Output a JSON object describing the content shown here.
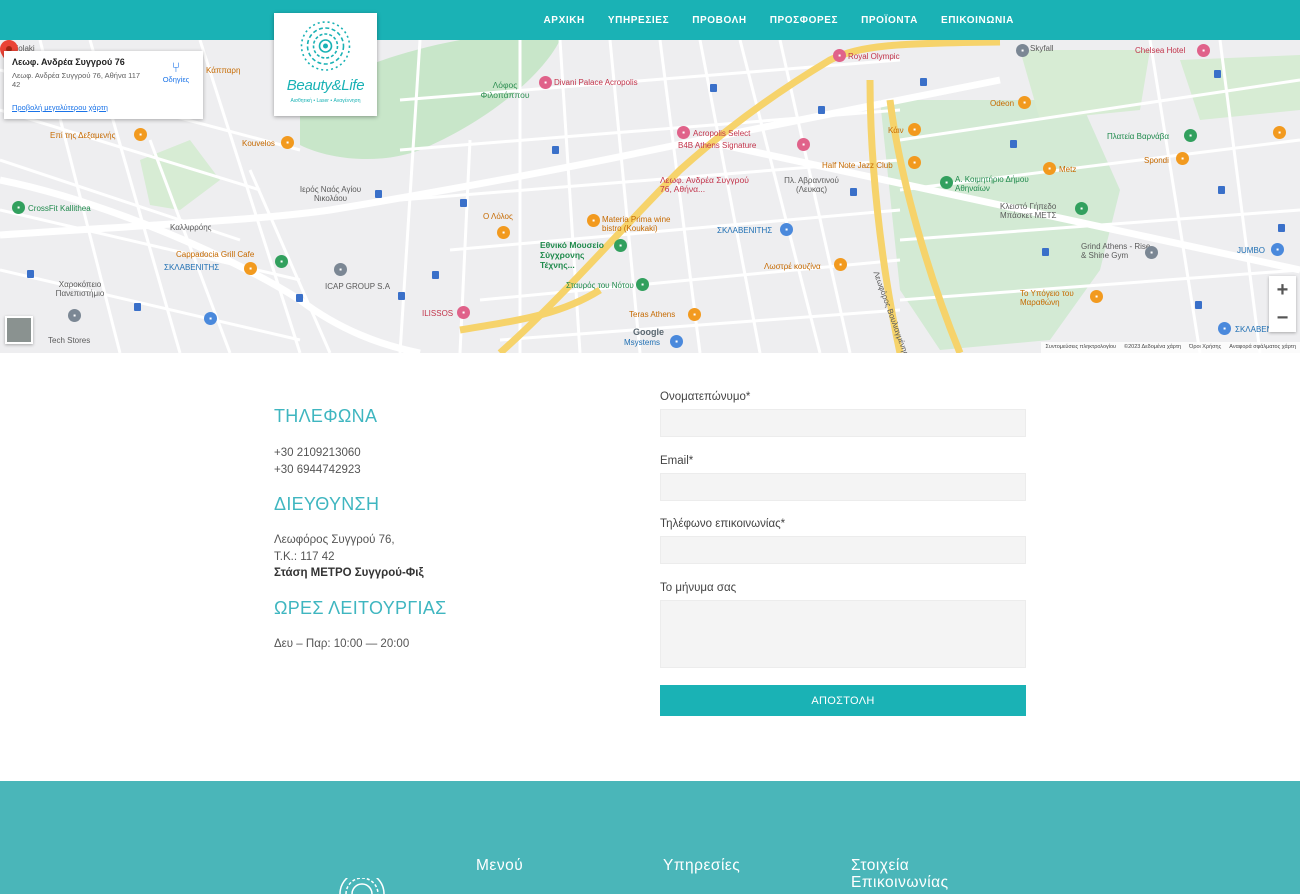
{
  "nav": {
    "items": [
      "ΑΡΧΙΚΗ",
      "ΥΠΗΡΕΣΙΕΣ",
      "ΠΡΟΒΟΛΗ",
      "ΠΡΟΣΦΟΡΕΣ",
      "ΠΡΟΪΟΝΤΑ",
      "ΕΠΙΚΟΙΝΩΝΙΑ"
    ]
  },
  "logo": {
    "name": "Beauty&Life",
    "tagline": "Αισθητική • Laser • Αναγέννηση"
  },
  "map": {
    "card_title": "Λεωφ. Ανδρέα Συγγρού 76",
    "card_address": "Λεωφ. Ανδρέα Συγγρού 76, Αθήνα 117 42",
    "card_link": "Προβολή μεγαλύτερου χάρτη",
    "directions": "Οδηγίες",
    "pin_label": "Λεωφ. Ανδρέα Συγγρού 76, Αθήνα...",
    "google": "Google",
    "zoom_in": "+",
    "zoom_out": "−",
    "attribution": [
      "Συντομεύσεις πληκτρολογίου",
      "©2023 Δεδομένα χάρτη",
      "Όροι Χρήσης",
      "Αναφορά σφάλματος χάρτη"
    ],
    "labels": {
      "acropolis_hotel": "Divani Palace Acropolis",
      "filopappou": "Λόφος Φιλοπάππου",
      "royal_olympic": "Royal Olympic",
      "chelsea": "Chelsea Hotel",
      "skyfall": "Skyfall",
      "acropolis_select": "Acropolis Select",
      "b4b": "B4B Athens Signature",
      "half_note": "Half Note Jazz Club",
      "kain": "Κάιν",
      "odeon": "Odeon",
      "varnava": "Πλατεία Βαρνάβα",
      "spondi": "Spondi",
      "metz": "Metz",
      "koimitirio": "Α. Κοιμητήριο Δήμου Αθηναίων",
      "klisto": "Κλειστό Γήπεδο Μπάσκετ ΜΕΤΣ",
      "grind": "Grind Athens - Rise & Shine Gym",
      "jumbo": "JUMBO",
      "ypogeio": "Το Υπόγειο του Μαραθώνη",
      "sklavenitis_r": "ΣΚΛΑΒΕΝΙΤΗΣ",
      "sklavenitis_m": "ΣΚΛΑΒΕΝΙΤΗΣ",
      "sklavenitis_l": "ΣΚΛΑΒΕΝΙΤΗΣ",
      "lostre": "Λωστρέ κουζίνα",
      "teras": "Teras Athens",
      "msystems": "Msystems",
      "stavros": "Σταυρός του Νότου",
      "emst": "Εθνικό Μουσείο Σύγχρονης Τέχνης...",
      "materia": "Materia Prima wine bistro (Koukaki)",
      "lolos": "Ο Λόλος",
      "ilissos": "ILISSOS",
      "icap": "ICAP GROUP S.A",
      "cappadocia": "Cappadocia Grill Cafe",
      "crossfit": "CrossFit Kallithea",
      "xarokopeio": "Χαροκόπειο Πανεπιστήμιο",
      "tech": "Tech Stores",
      "kouvelos": "Kouvelos",
      "kappari": "Κάππαρη",
      "dexameni": "Επί της Δεξαμενής",
      "naos": "Ιερός Ναός Αγίου Νικολάου",
      "plabr": "Πλ. Αβραντινού (Λευκας)",
      "kallirrois": "Καλλιρρόης",
      "syggrou": "Λεωφόρος Βουλιαγμένης",
      "periolaki": "Periolaki"
    }
  },
  "contact": {
    "phones_title": "ΤΗΛΕΦΩΝΑ",
    "phone1": "+30 2109213060",
    "phone2": "+30 6944742923",
    "address_title": "ΔΙΕΥΘΥΝΣΗ",
    "address1": "Λεωφόρος Συγγρού 76,",
    "address2": "Τ.Κ.: 117 42",
    "metro": "Στάση ΜΕΤΡΟ Συγγρού-Φιξ",
    "hours_title": "ΩΡΕΣ ΛΕΙΤΟΥΡΓΙΑΣ",
    "hours": "Δευ – Παρ: 10:00 — 20:00"
  },
  "form": {
    "name_label": "Ονοματεπώνυμο*",
    "email_label": "Email*",
    "phone_label": "Τηλέφωνο επικοινωνίας*",
    "message_label": "Το μήνυμα σας",
    "submit": "ΑΠΟΣΤΟΛΗ"
  },
  "footer": {
    "menu_title": "Μενού",
    "services_title": "Υπηρεσίες",
    "contact_title_1": "Στοιχεία",
    "contact_title_2": "Επικοινωνίας"
  },
  "colors": {
    "brand": "#1ab2b5",
    "footer": "#4ab6b9",
    "heading": "#3fb6c0"
  }
}
